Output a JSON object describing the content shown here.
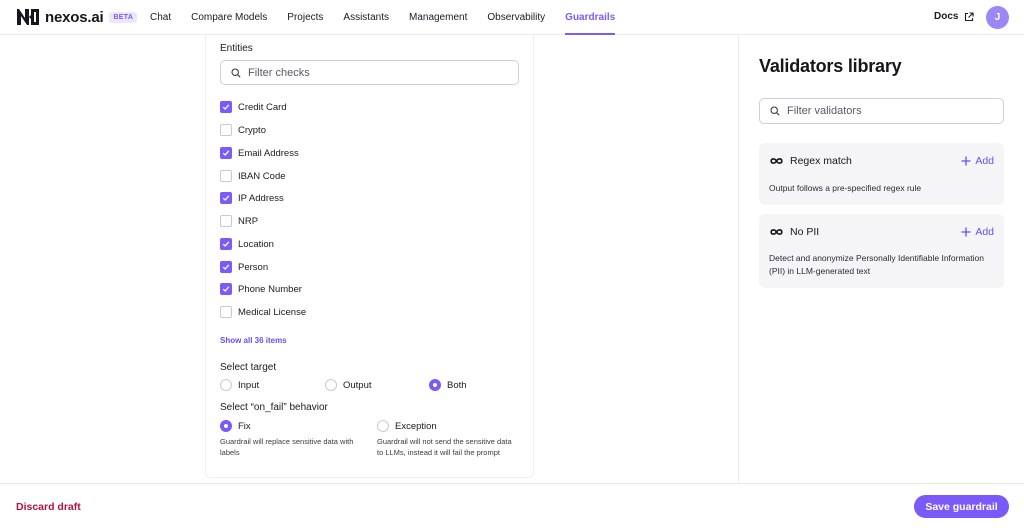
{
  "brand": {
    "name": "nexos.ai",
    "badge": "BETA"
  },
  "nav": {
    "links": [
      {
        "label": "Chat"
      },
      {
        "label": "Compare Models"
      },
      {
        "label": "Projects"
      },
      {
        "label": "Assistants"
      },
      {
        "label": "Management"
      },
      {
        "label": "Observability"
      },
      {
        "label": "Guardrails",
        "active": true
      }
    ],
    "docs_label": "Docs",
    "avatar_initial": "J"
  },
  "entities": {
    "label": "Entities",
    "filter_placeholder": "Filter checks",
    "items": [
      {
        "label": "Credit Card",
        "checked": true
      },
      {
        "label": "Crypto",
        "checked": false
      },
      {
        "label": "Email Address",
        "checked": true
      },
      {
        "label": "IBAN Code",
        "checked": false
      },
      {
        "label": "IP Address",
        "checked": true
      },
      {
        "label": "NRP",
        "checked": false
      },
      {
        "label": "Location",
        "checked": true
      },
      {
        "label": "Person",
        "checked": true
      },
      {
        "label": "Phone Number",
        "checked": true
      },
      {
        "label": "Medical License",
        "checked": false
      }
    ],
    "show_all_label": "Show all 36 items"
  },
  "target": {
    "label": "Select target",
    "options": [
      {
        "label": "Input",
        "selected": false
      },
      {
        "label": "Output",
        "selected": false
      },
      {
        "label": "Both",
        "selected": true
      }
    ]
  },
  "on_fail": {
    "label": "Select “on_fail” behavior",
    "options": [
      {
        "label": "Fix",
        "selected": true,
        "help": "Guardrail will replace sensitive data with labels"
      },
      {
        "label": "Exception",
        "selected": false,
        "help": "Guardrail will not send the sensitive data to LLMs, instead it will fail the prompt"
      }
    ]
  },
  "library": {
    "title": "Validators library",
    "filter_placeholder": "Filter validators",
    "validators": [
      {
        "name": "Regex match",
        "add_label": "Add",
        "description": "Output follows a pre-specified regex rule"
      },
      {
        "name": "No PII",
        "add_label": "Add",
        "description": "Detect and anonymize Personally Identifiable Information (PII) in LLM-generated text"
      }
    ]
  },
  "footer": {
    "discard_label": "Discard draft",
    "save_label": "Save guardrail"
  },
  "colors": {
    "accent": "#7a5af8",
    "danger": "#b3133f"
  },
  "icons": [
    "nexos-logo-icon",
    "external-link-icon",
    "search-icon",
    "checkmark-icon",
    "infinity-icon",
    "plus-icon"
  ]
}
